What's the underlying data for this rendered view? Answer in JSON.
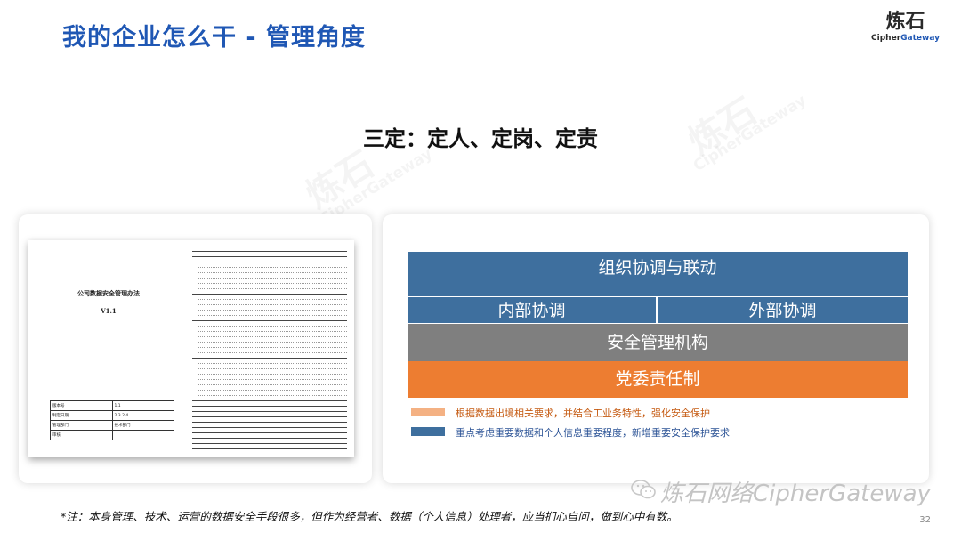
{
  "header": {
    "title": "我的企业怎么干 - 管理角度",
    "logo_cn": "炼石",
    "logo_en_a": "Cipher",
    "logo_en_b": "Gateway"
  },
  "subtitle": "三定：定人、定岗、定责",
  "document": {
    "title": "公司数据安全管理办法",
    "version": "V1.1",
    "meta": [
      [
        "版本号",
        "1.1"
      ],
      [
        "制定日期",
        "2.3.2.4"
      ],
      [
        "管理部门",
        "技术部门"
      ],
      [
        "审核",
        ""
      ]
    ]
  },
  "org": {
    "top": "组织协调与联动",
    "left": "内部协调",
    "right": "外部协调",
    "mgmt": "安全管理机构",
    "party": "党委责任制"
  },
  "legend": [
    {
      "color": "#f4b183",
      "text": "根据数据出境相关要求，并结合工业务特性，强化安全保护",
      "text_color": "#c55a11"
    },
    {
      "color": "#3e6f9e",
      "text": "重点考虑重要数据和个人信息重要程度，新增重要安全保护要求",
      "text_color": "#2e5597"
    }
  ],
  "colors": {
    "title": "#1f57b4",
    "blue_bar": "#3e6f9e",
    "gray_bar": "#7f7f7f",
    "orange_bar": "#ed7d31"
  },
  "watermark": {
    "cn": "炼石",
    "en": "CipherGateway"
  },
  "footer": {
    "note": "*注：本身管理、技术、运营的数据安全手段很多，但作为经营者、数据（个人信息）处理者，应当扪心自问，做到心中有数。",
    "wechat": "炼石网络CipherGateway",
    "page": "32"
  }
}
